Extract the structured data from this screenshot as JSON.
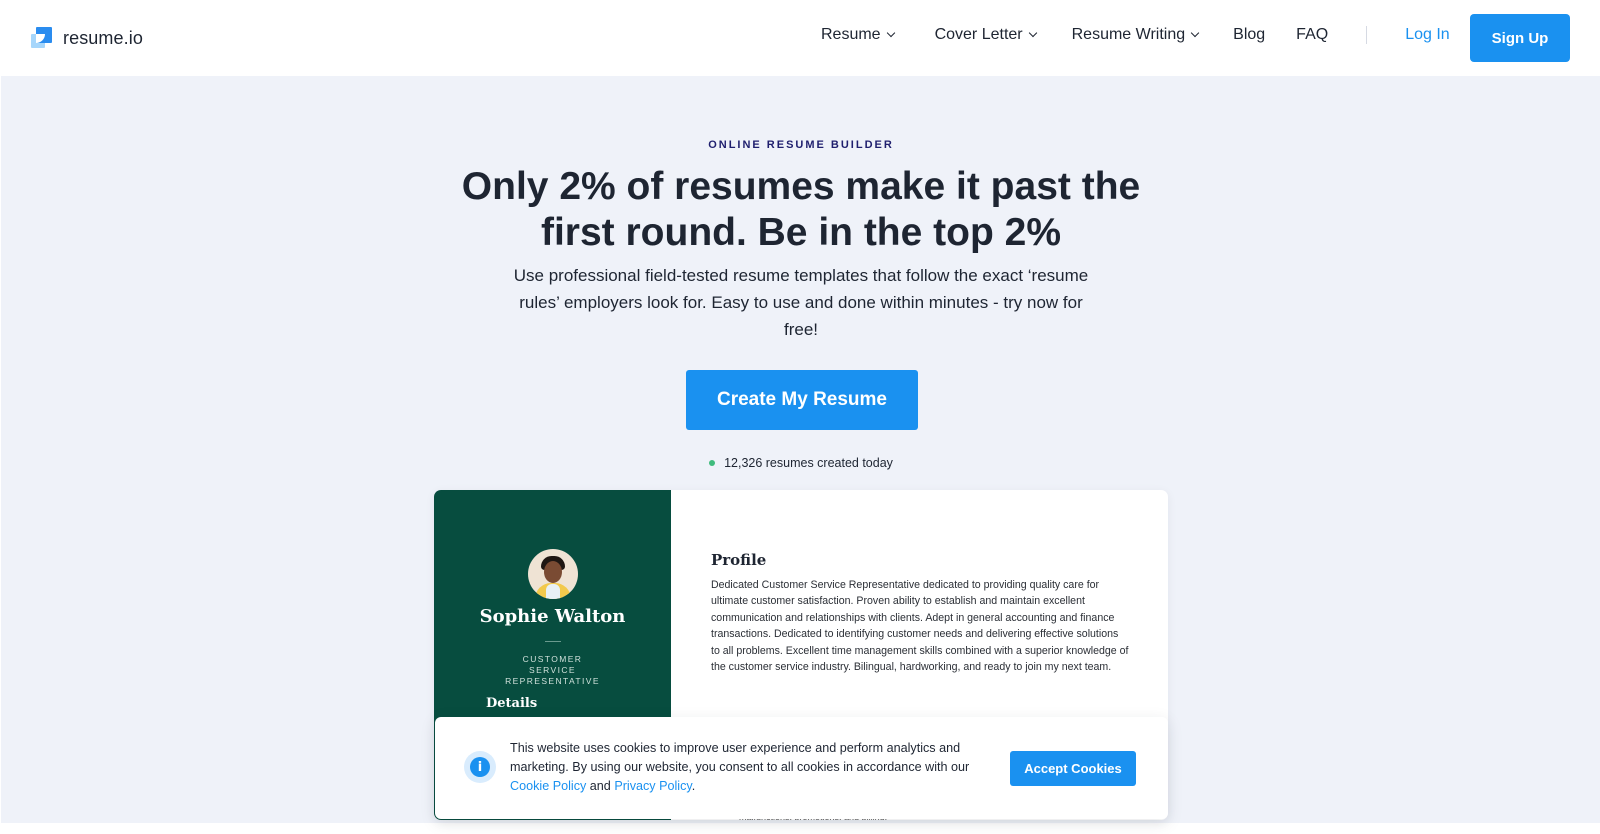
{
  "header": {
    "logo_text": "resume.io",
    "nav": [
      {
        "label": "Resume",
        "has_dropdown": true
      },
      {
        "label": "Cover Letter",
        "has_dropdown": true
      },
      {
        "label": "Resume Writing",
        "has_dropdown": true
      },
      {
        "label": "Blog",
        "has_dropdown": false
      },
      {
        "label": "FAQ",
        "has_dropdown": false
      }
    ],
    "login_label": "Log In",
    "signup_label": "Sign Up"
  },
  "hero": {
    "eyebrow": "ONLINE RESUME BUILDER",
    "headline_line1": "Only 2% of resumes make it past the",
    "headline_line2": "first round. Be in the top 2%",
    "subtext": "Use professional field-tested resume templates that follow the exact ‘resume rules’ employers look for. Easy to use and done within minutes - try now for free!",
    "cta_label": "Create My Resume",
    "counter_text": "12,326 resumes created today"
  },
  "resume_preview": {
    "name": "Sophie Walton",
    "job_title": "CUSTOMER SERVICE REPRESENTATIVE",
    "details_heading": "Details",
    "profile_heading": "Profile",
    "profile_text": "Dedicated Customer Service Representative dedicated to providing quality care for ultimate customer satisfaction. Proven ability to establish and maintain excellent communication and relationships with clients. Adept in general accounting and finance transactions. Dedicated to identifying customer needs and delivering effective solutions to all problems. Excellent time management skills combined with a superior knowledge of the customer service industry. Bilingual, hardworking, and ready to join my next team.",
    "partial_line": "malfunctions, promotions, and billing."
  },
  "cookie_banner": {
    "text_before": "This website uses cookies to improve user experience and perform analytics and marketing. By using our website, you consent to all cookies in accordance with our ",
    "cookie_policy_label": "Cookie Policy",
    "and_text": " and ",
    "privacy_policy_label": "Privacy Policy",
    "text_after": ".",
    "accept_label": "Accept Cookies",
    "icon": "info-icon"
  },
  "colors": {
    "accent": "#1a91f0",
    "hero_bg": "#eff2f9",
    "resume_sidebar": "#074d3f",
    "counter_dot": "#3fbb7d"
  }
}
